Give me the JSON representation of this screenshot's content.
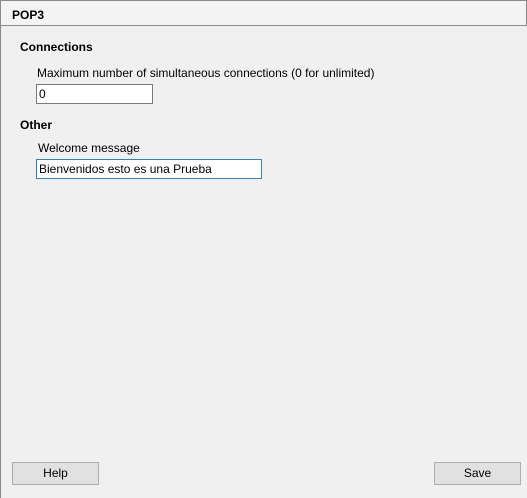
{
  "header": {
    "title": "POP3"
  },
  "connections": {
    "section_title": "Connections",
    "max_connections_label": "Maximum number of simultaneous connections (0 for unlimited)",
    "max_connections_value": "0"
  },
  "other": {
    "section_title": "Other",
    "welcome_label": "Welcome message",
    "welcome_value": "Bienvenidos esto es una Prueba"
  },
  "buttons": {
    "help_label": "Help",
    "save_label": "Save"
  }
}
